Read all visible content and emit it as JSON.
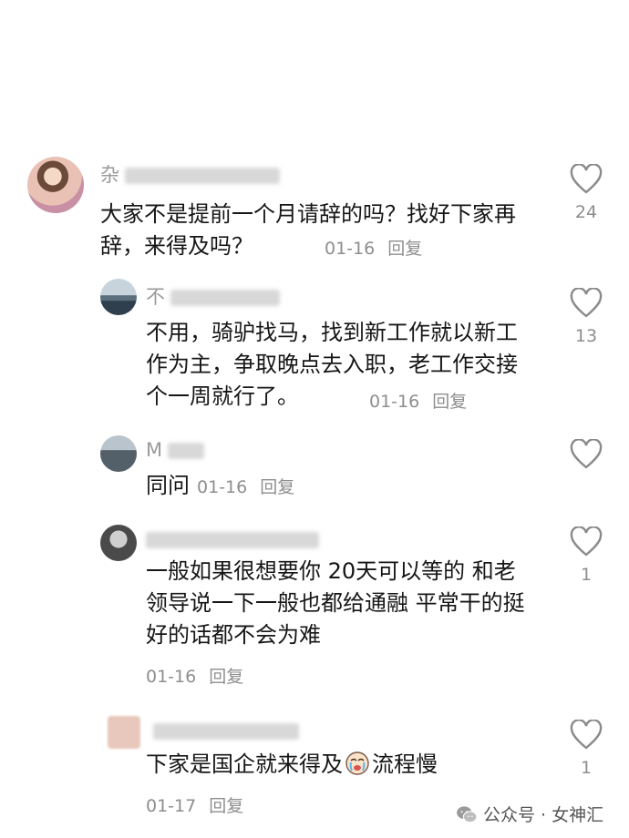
{
  "comments": [
    {
      "user": "杂",
      "text": "大家不是提前一个月请辞的吗？找好下家再辞，来得及吗？",
      "time": "01-16",
      "reply": "回复",
      "likes": "24"
    },
    {
      "user": "不",
      "text": "不用，骑驴找马，找到新工作就以新工作为主，争取晚点去入职，老工作交接个一周就行了。",
      "time": "01-16",
      "reply": "回复",
      "likes": "13"
    },
    {
      "user": "M",
      "text": "同问",
      "time": "01-16",
      "reply": "回复",
      "likes": ""
    },
    {
      "user": "",
      "text": "一般如果很想要你 20天可以等的 和老领导说一下一般也都给通融 平常干的挺好的话都不会为难",
      "time": "01-16",
      "reply": "回复",
      "likes": "1"
    },
    {
      "user": "",
      "text_before": "下家是国企就来得及",
      "text_after": "流程慢",
      "emoji": "crying-face",
      "time": "01-17",
      "reply": "回复",
      "likes": "1"
    }
  ],
  "watermark": {
    "text": "公众号 · 女神汇",
    "icon": "wechat-icon"
  },
  "colors": {
    "text": "#161616",
    "meta": "#8e8e8e",
    "heart_outline": "#8a8a8a"
  }
}
